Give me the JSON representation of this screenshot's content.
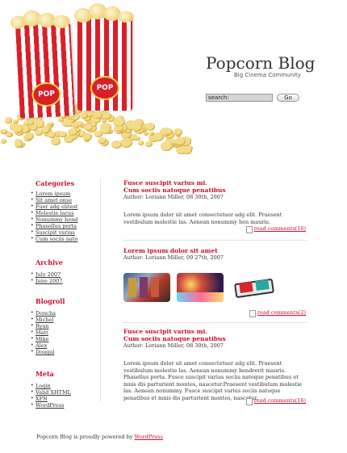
{
  "header": {
    "title": "Popcorn Blog",
    "subtitle": "Big Cinema Community",
    "search_value": "search:",
    "go_label": "Go"
  },
  "sidebar": {
    "categories_title": "Categories",
    "categories": [
      "Lorem ipsum",
      "Sit amet onse",
      "Fuer adg elitest",
      "Molestie lacus",
      "Nonummy hend",
      "Phasellus porta",
      "Suscipit varius",
      "Cum sociis nato"
    ],
    "archive_title": "Archive",
    "archive": [
      "July 2007",
      "June 2007"
    ],
    "blogroll_title": "Blogroll",
    "blogroll": [
      "Doncha",
      "Michel",
      "Ryan",
      "Matt",
      "Mike",
      "Alex",
      "Dougal"
    ],
    "meta_title": "Meta",
    "meta": [
      "Login",
      "Valid XHTML",
      "XFN",
      "WordPress"
    ]
  },
  "posts": [
    {
      "title_line1": "Fusce suscipit varius mi.",
      "title_line2": "Cum sociis natoque penatibus",
      "meta": "Author: Loriann Miller, 08 30th, 2007",
      "body": "Lorem ipsum dolor sit amet consectetuer adg elit. Praesent vestibulum molestie las. Aenean nonummy hen mauris.",
      "comments": "read comments(16)"
    },
    {
      "title": "Lorem ipsum dolor sit amet",
      "meta": "Author: Loriann Miller, 09 27th, 2007",
      "comments": "read comments(2)"
    },
    {
      "title_line1": "Fusce suscipit varius mi.",
      "title_line2": "Cum sociis natoque penatibus",
      "meta": "Author: Loriann Miller, 08 30th, 2007",
      "body": "Lorem ipsum dolor sit amet consectetuer adg elit. Praesent vestibulum molestie las. Aenean nonummy hendrerit mauris. Phasellus porta. Fusce suscipit varius sociis natoque penatibus et mnis dis parturient montes, nascetur.Praesent vestibulum molestie las. Aenean nonummy. Fusce suscipit varius sociis natoque penatibus et mnis dis parturient montes, nascetur.",
      "comments": "read comments(16)"
    }
  ],
  "footer": {
    "text": "Popcorn Blog is proudly powered by",
    "link": "WordPress"
  },
  "colors": {
    "accent": "#c8102e",
    "box_stripe": "#d9202a"
  }
}
